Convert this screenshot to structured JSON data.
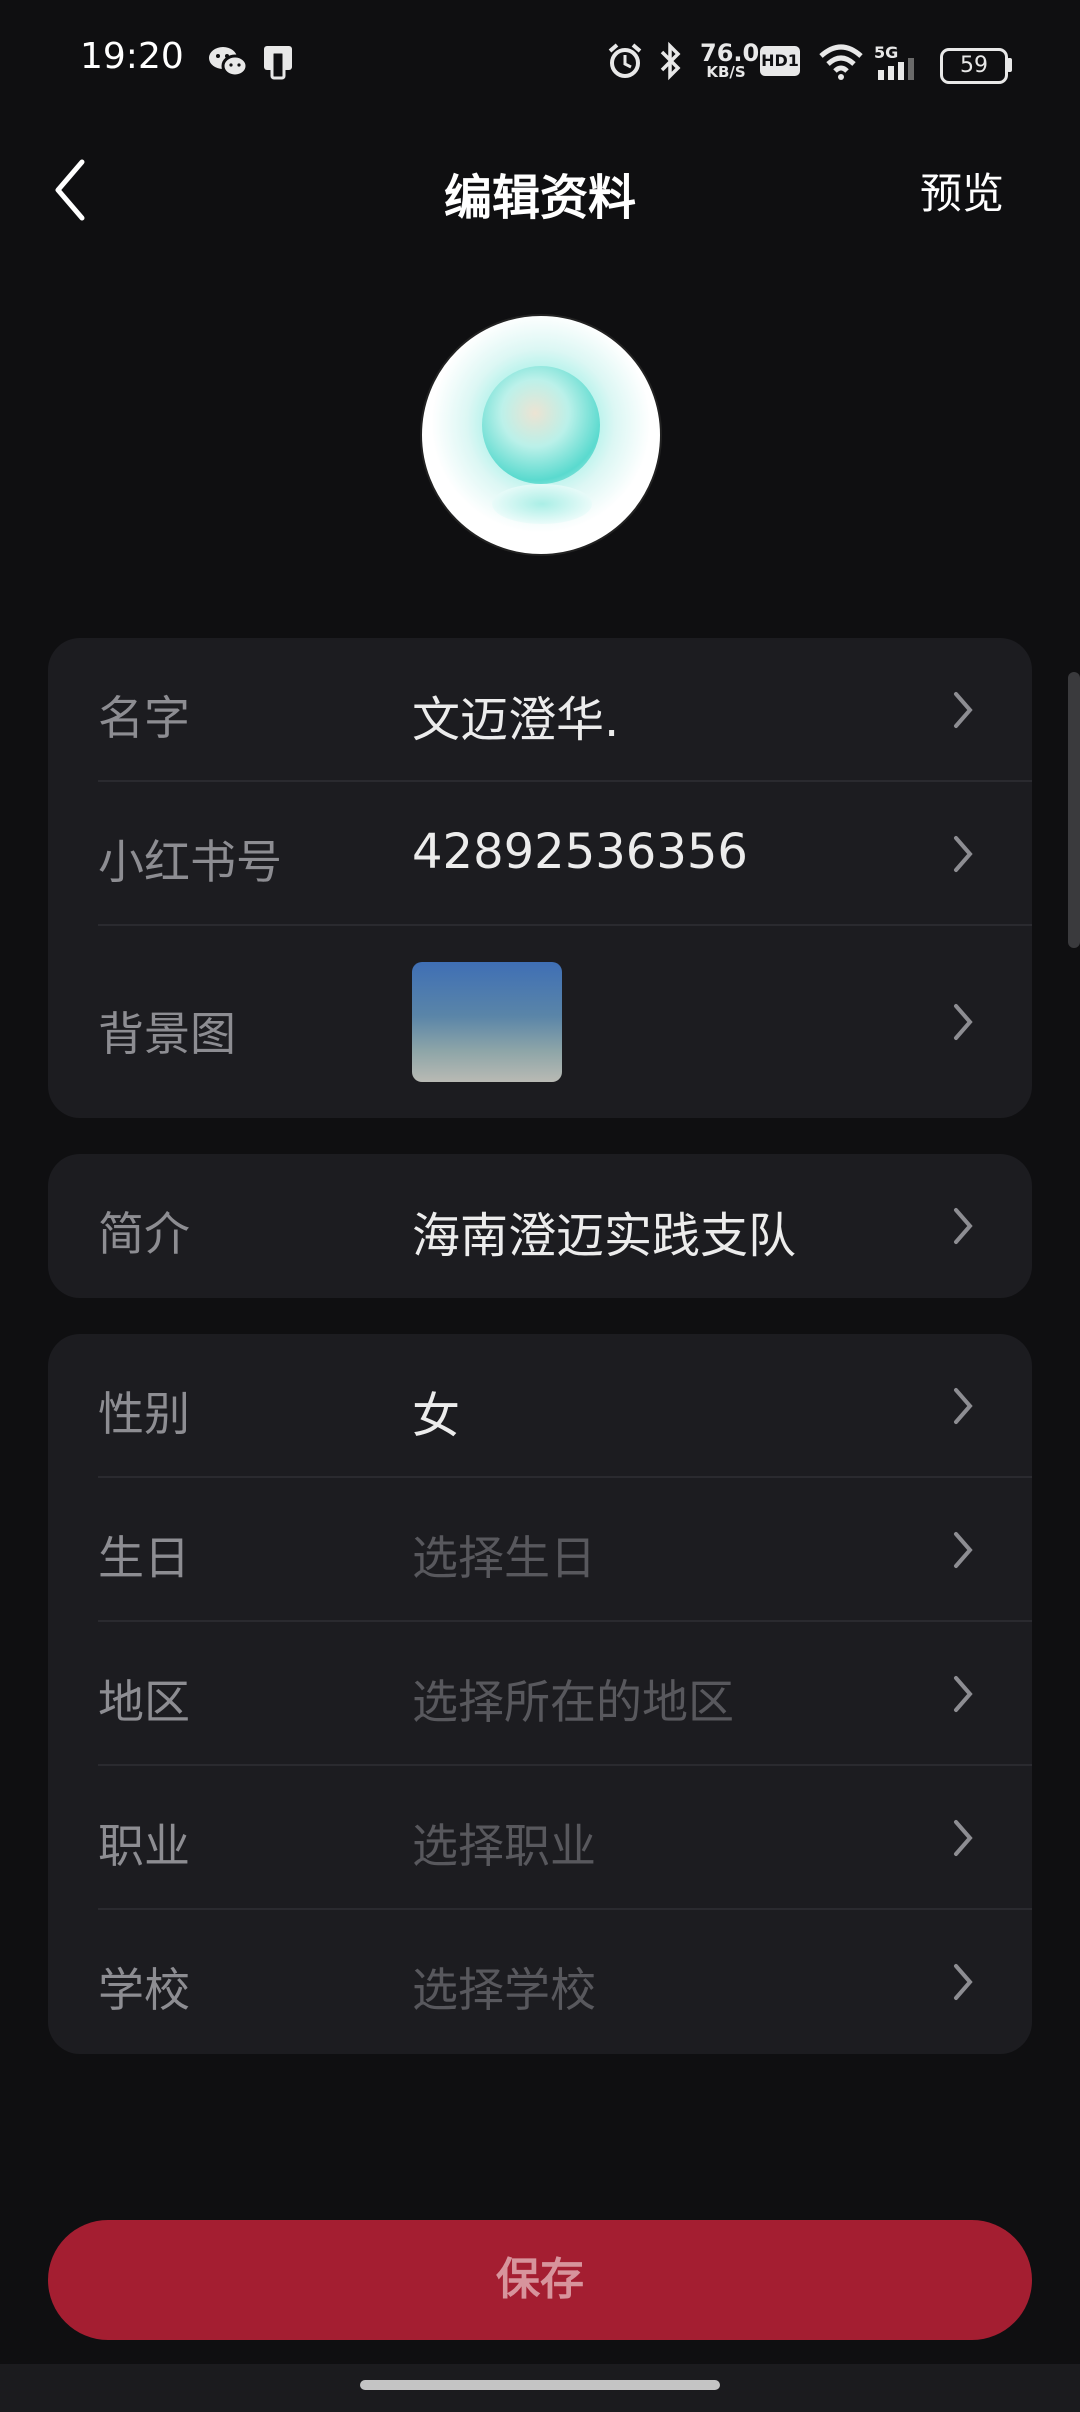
{
  "status_bar": {
    "time": "19:20",
    "net_speed_value": "76.0",
    "net_speed_unit": "KB/S",
    "hd_badge": "HD1",
    "signal_label": "5G",
    "battery": "59"
  },
  "header": {
    "title": "编辑资料",
    "preview_label": "预览"
  },
  "profile": {
    "rows_group1": [
      {
        "label": "名字",
        "value": "文迈澄华."
      },
      {
        "label": "小红书号",
        "value": "42892536356"
      },
      {
        "label": "背景图"
      }
    ],
    "intro": {
      "label": "简介",
      "value": "海南澄迈实践支队"
    },
    "rows_group3": [
      {
        "label": "性别",
        "value": "女"
      },
      {
        "label": "生日",
        "placeholder": "选择生日"
      },
      {
        "label": "地区",
        "placeholder": "选择所在的地区"
      },
      {
        "label": "职业",
        "placeholder": "选择职业"
      },
      {
        "label": "学校",
        "placeholder": "选择学校"
      }
    ]
  },
  "save_label": "保存",
  "colors": {
    "background": "#0f0f11",
    "card": "#1c1c20",
    "save_button": "#a41e31",
    "label_text": "#8d8d92",
    "placeholder_text": "#58585d"
  }
}
